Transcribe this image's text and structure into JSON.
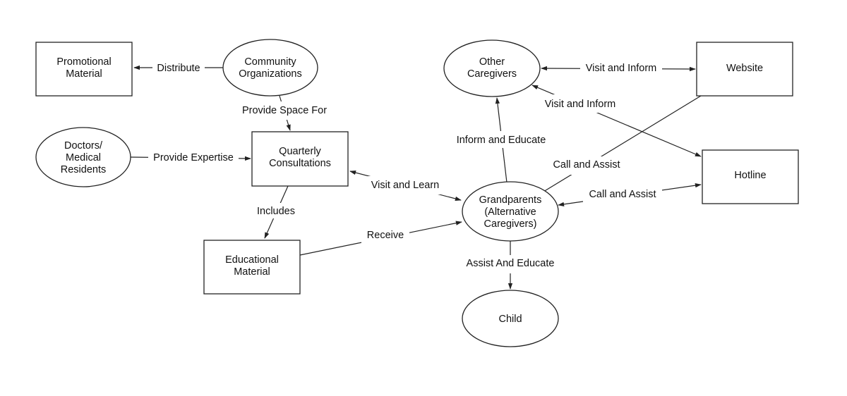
{
  "diagram": {
    "nodes": {
      "promotional_material": {
        "shape": "rectangle",
        "lines": [
          "Promotional",
          "Material"
        ]
      },
      "community_organizations": {
        "shape": "ellipse",
        "lines": [
          "Community",
          "Organizations"
        ]
      },
      "doctors": {
        "shape": "ellipse",
        "lines": [
          "Doctors/",
          "Medical",
          "Residents"
        ]
      },
      "quarterly_consultations": {
        "shape": "rectangle",
        "lines": [
          "Quarterly",
          "Consultations"
        ]
      },
      "educational_material": {
        "shape": "rectangle",
        "lines": [
          "Educational",
          "Material"
        ]
      },
      "other_caregivers": {
        "shape": "ellipse",
        "lines": [
          "Other",
          "Caregivers"
        ]
      },
      "website": {
        "shape": "rectangle",
        "lines": [
          "Website"
        ]
      },
      "hotline": {
        "shape": "rectangle",
        "lines": [
          "Hotline"
        ]
      },
      "grandparents": {
        "shape": "ellipse",
        "lines": [
          "Grandparents",
          "(Alternative",
          "Caregivers)"
        ]
      },
      "child": {
        "shape": "ellipse",
        "lines": [
          "Child"
        ]
      }
    },
    "edges": [
      {
        "from": "Community Organizations",
        "to": "Promotional Material",
        "label": "Distribute"
      },
      {
        "from": "Community Organizations",
        "to": "Quarterly Consultations",
        "label": "Provide Space For"
      },
      {
        "from": "Doctors/Medical Residents",
        "to": "Quarterly Consultations",
        "label": "Provide Expertise"
      },
      {
        "from": "Grandparents",
        "to": "Quarterly Consultations",
        "label": "Visit and Learn",
        "bidirectional": true
      },
      {
        "from": "Quarterly Consultations",
        "to": "Educational Material",
        "label": "Includes"
      },
      {
        "from": "Educational Material",
        "to": "Grandparents",
        "label": "Receive"
      },
      {
        "from": "Grandparents",
        "to": "Other Caregivers",
        "label": "Inform and Educate"
      },
      {
        "from": "Other Caregivers",
        "to": "Website",
        "label": "Visit and Inform",
        "bidirectional": true
      },
      {
        "from": "Hotline",
        "to": "Other Caregivers",
        "label": "Visit and Inform",
        "bidirectional": true
      },
      {
        "from": "Grandparents",
        "to": "Website",
        "label": "Call and Assist"
      },
      {
        "from": "Grandparents",
        "to": "Hotline",
        "label": "Call and Assist",
        "bidirectional": true
      },
      {
        "from": "Grandparents",
        "to": "Child",
        "label": "Assist And Educate"
      }
    ]
  }
}
